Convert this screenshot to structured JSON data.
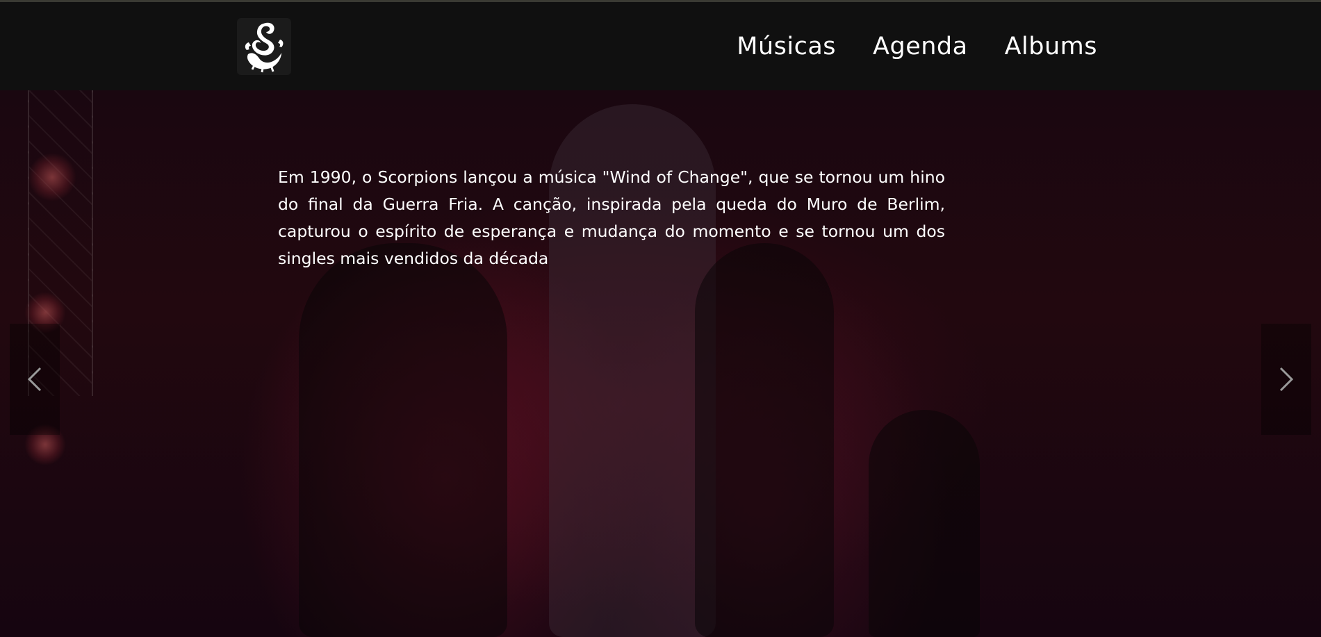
{
  "header": {
    "logo_icon": "scorpion-logo-icon",
    "nav": [
      {
        "label": "Músicas"
      },
      {
        "label": "Agenda"
      },
      {
        "label": "Albums"
      }
    ]
  },
  "hero": {
    "background": "concert-photo-band-on-stage",
    "text": "Em 1990, o Scorpions lançou a música \"Wind of Change\", que se tornou um hino do final da Guerra Fria. A canção, inspirada pela queda do Muro de Berlim, capturou o espírito de esperança e mudança do momento e se tornou um dos singles mais vendidos da década"
  },
  "carousel": {
    "prev_icon": "chevron-left-icon",
    "next_icon": "chevron-right-icon"
  },
  "colors": {
    "navbar_bg": "#101010",
    "text": "#ffffff",
    "hero_tint": "#22080f"
  }
}
